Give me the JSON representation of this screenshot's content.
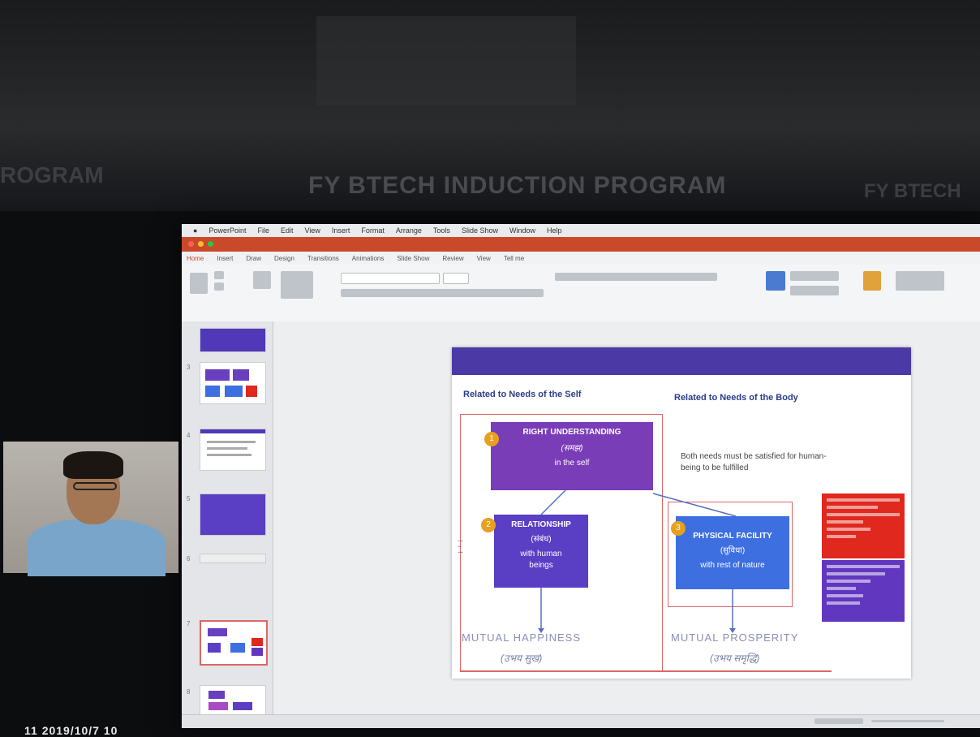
{
  "background": {
    "banner_main": "FY BTECH INDUCTION PROGRAM",
    "banner_left": "ROGRAM",
    "banner_right": "FY BTECH"
  },
  "mac_menubar": {
    "items": [
      "PowerPoint",
      "File",
      "Edit",
      "View",
      "Insert",
      "Format",
      "Arrange",
      "Tools",
      "Slide Show",
      "Window",
      "Help"
    ]
  },
  "ribbon_tabs": [
    "Home",
    "Insert",
    "Draw",
    "Design",
    "Transitions",
    "Animations",
    "Slide Show",
    "Review",
    "View",
    "Tell me"
  ],
  "slide": {
    "header_left": "Related to Needs of the Self",
    "header_right": "Related to Needs of the Body",
    "box1_num": "1",
    "box1_line1": "RIGHT UNDERSTANDING",
    "box1_line2": "(समझ)",
    "box1_line3": "in the self",
    "box2_num": "2",
    "box2_line1": "RELATIONSHIP",
    "box2_line2": "(संबंध)",
    "box2_line3": "with human",
    "box2_line4": "beings",
    "box3_num": "3",
    "box3_line1": "PHYSICAL FACILITY",
    "box3_line2": "(सुविधा)",
    "box3_line3": "with rest of nature",
    "note": "Both needs must be satisfied for human-being to be fulfilled",
    "label_happiness": "MUTUAL HAPPINESS",
    "label_happiness_sub": "(उभय सुख)",
    "label_prosperity": "MUTUAL PROSPERITY",
    "label_prosperity_sub": "(उभय समृद्धि)"
  },
  "thumbnail_numbers": [
    "3",
    "4",
    "5",
    "6",
    "7",
    "8"
  ],
  "timestamp": "11 2019/10/7 10"
}
